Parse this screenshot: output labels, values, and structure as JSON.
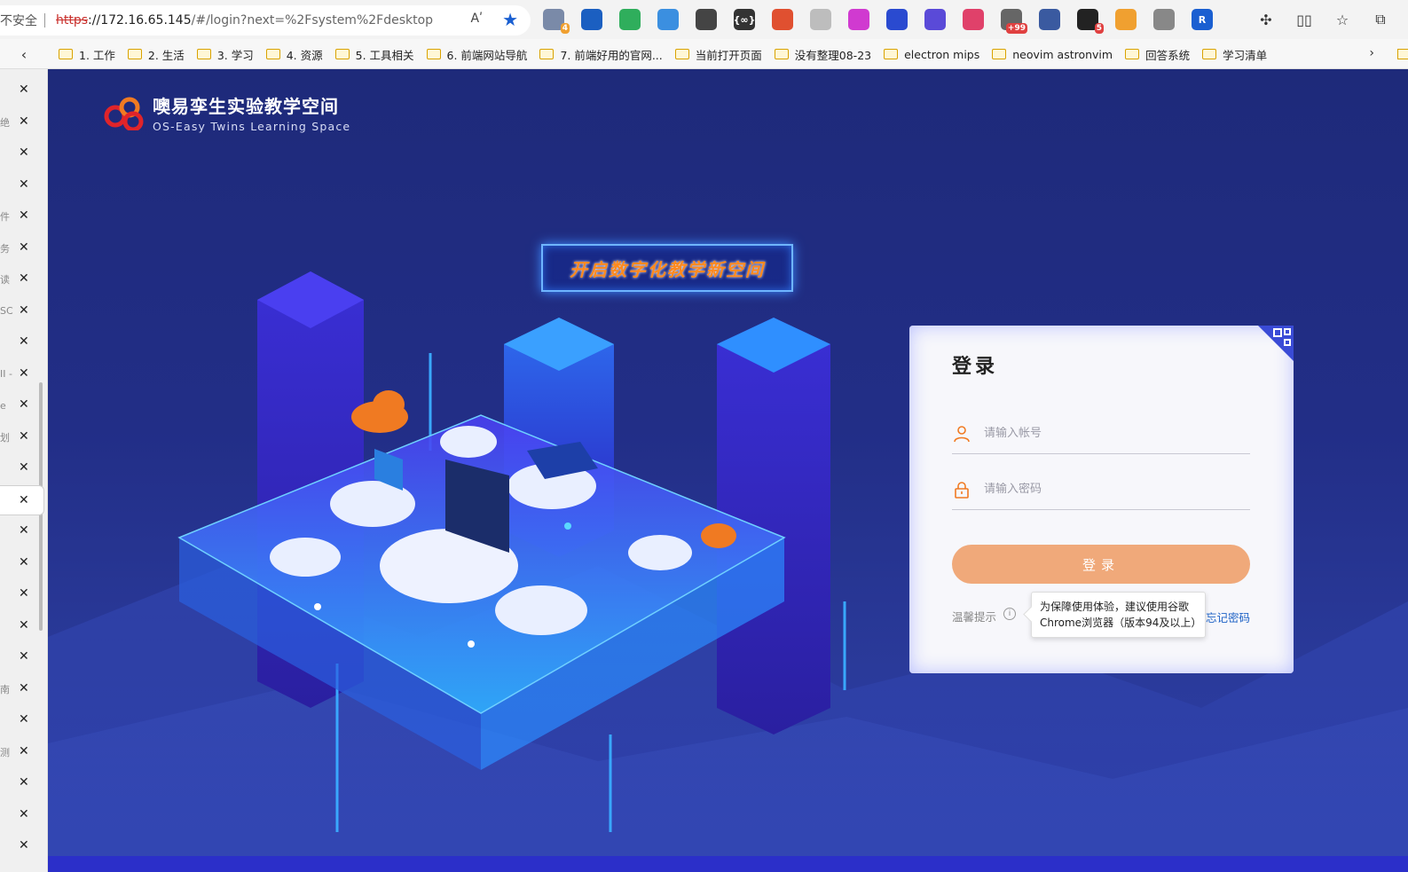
{
  "browser": {
    "security_label": "不安全",
    "url_scheme": "https",
    "url_host": "://172.16.65.145",
    "url_rest": "/#/login?next=%2Fsystem%2Fdesktop",
    "read_aloud_label": "Aʹ",
    "extensions": [
      {
        "name": "ext-1",
        "color": "#7a8aa8",
        "text": "",
        "badge": "4"
      },
      {
        "name": "ext-2",
        "color": "#1b5fc1",
        "text": "",
        "badge": ""
      },
      {
        "name": "ext-3",
        "color": "#2fae5c",
        "text": "",
        "badge": ""
      },
      {
        "name": "ext-4",
        "color": "#3b8fe0",
        "text": "",
        "badge": ""
      },
      {
        "name": "ext-5",
        "color": "#444444",
        "text": "",
        "badge": ""
      },
      {
        "name": "ext-6",
        "color": "#333333",
        "text": "{∞}",
        "badge": ""
      },
      {
        "name": "ext-7",
        "color": "#e05030",
        "text": "",
        "badge": ""
      },
      {
        "name": "ext-8",
        "color": "#bdbdbd",
        "text": "",
        "badge": ""
      },
      {
        "name": "ext-9",
        "color": "#d03ad0",
        "text": "",
        "badge": ""
      },
      {
        "name": "ext-10",
        "color": "#2a4ad0",
        "text": "",
        "badge": ""
      },
      {
        "name": "ext-11",
        "color": "#5a4ad8",
        "text": "",
        "badge": ""
      },
      {
        "name": "ext-12",
        "color": "#e0416a",
        "text": "",
        "badge": ""
      },
      {
        "name": "ext-13",
        "color": "#666666",
        "text": "",
        "badge": "+99"
      },
      {
        "name": "ext-14",
        "color": "#3a5aa0",
        "text": "",
        "badge": ""
      },
      {
        "name": "ext-15",
        "color": "#222222",
        "text": "",
        "badge": "5"
      },
      {
        "name": "ext-16",
        "color": "#f0a030",
        "text": "",
        "badge": ""
      },
      {
        "name": "ext-17",
        "color": "#888888",
        "text": "",
        "badge": ""
      },
      {
        "name": "ext-18",
        "color": "#1a5fd1",
        "text": "R",
        "badge": ""
      }
    ]
  },
  "bookmarks": [
    "1. 工作",
    "2. 生活",
    "3. 学习",
    "4. 资源",
    "5. 工具相关",
    "6. 前端网站导航",
    "7. 前端好用的官网...",
    "当前打开页面",
    "没有整理08-23",
    "electron mips",
    "neovim astronvim",
    "回答系统",
    "学习清单"
  ],
  "vtabs": [
    {
      "frag": ""
    },
    {
      "frag": "绝"
    },
    {
      "frag": ""
    },
    {
      "frag": ""
    },
    {
      "frag": "件"
    },
    {
      "frag": "务"
    },
    {
      "frag": "读"
    },
    {
      "frag": "SC"
    },
    {
      "frag": ""
    },
    {
      "frag": "II -"
    },
    {
      "frag": "e"
    },
    {
      "frag": "划"
    },
    {
      "frag": ""
    },
    {
      "frag": ""
    },
    {
      "frag": ""
    },
    {
      "frag": ""
    },
    {
      "frag": ""
    },
    {
      "frag": ""
    },
    {
      "frag": ""
    },
    {
      "frag": "南"
    },
    {
      "frag": ""
    },
    {
      "frag": "测"
    },
    {
      "frag": ""
    },
    {
      "frag": ""
    },
    {
      "frag": ""
    }
  ],
  "page": {
    "logo_title": "噢易孪生实验教学空间",
    "logo_subtitle": "OS-Easy Twins Learning Space",
    "banner_text": "开启数字化教学新空间"
  },
  "login": {
    "title": "登录",
    "account_placeholder": "请输入帐号",
    "password_placeholder": "请输入密码",
    "button_label": "登录",
    "tip_label": "温馨提示",
    "tooltip_line1": "为保障使用体验，建议使用谷歌",
    "tooltip_line2": "Chrome浏览器（版本94及以上）",
    "forgot_label": "忘记密码"
  },
  "colors": {
    "page_bg": "#222e87",
    "accent_orange": "#f0a97a",
    "link_blue": "#1e62c6"
  }
}
